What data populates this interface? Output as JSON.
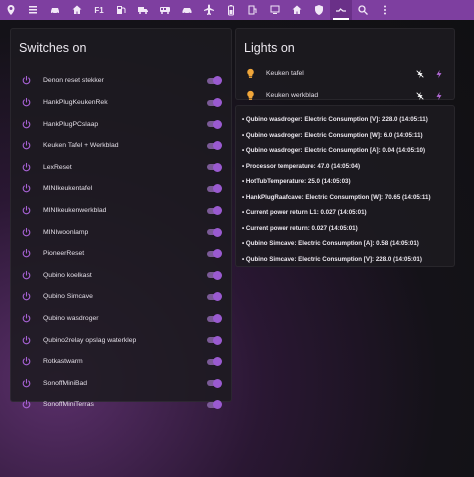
{
  "colors": {
    "accent": "#7e3fa0",
    "toggle_on": "#9a5ad0",
    "bulb": "#f0a63a",
    "bolt": "#b46ad8"
  },
  "toolbar": {
    "icons": [
      "map-marker-icon",
      "list-icon",
      "car-icon",
      "home-icon",
      "f1-icon",
      "fuel-icon",
      "truck-icon",
      "bus-icon",
      "car-icon",
      "plane-icon",
      "battery-icon",
      "charger-icon",
      "monitor-icon",
      "home-icon",
      "shield-icon",
      "switch-icon",
      "search-icon",
      "more-icon"
    ],
    "f1_label": "F1"
  },
  "switches_card": {
    "title": "Switches on",
    "items": [
      {
        "label": "Denon reset stekker",
        "state": "on"
      },
      {
        "label": "HankPlugKeukenRek",
        "state": "on"
      },
      {
        "label": "HankPlugPCslaap",
        "state": "on"
      },
      {
        "label": "Keuken Tafel + Werkblad",
        "state": "on"
      },
      {
        "label": "LexReset",
        "state": "on"
      },
      {
        "label": "MINIkeukentafel",
        "state": "on"
      },
      {
        "label": "MINIkeukenwerkblad",
        "state": "on"
      },
      {
        "label": "MINIwoonlamp",
        "state": "on"
      },
      {
        "label": "PioneerReset",
        "state": "on"
      },
      {
        "label": "Qubino koelkast",
        "state": "on"
      },
      {
        "label": "Qubino Simcave",
        "state": "on"
      },
      {
        "label": "Qubino wasdroger",
        "state": "on"
      },
      {
        "label": "Qubino2relay opslag waterklep",
        "state": "on"
      },
      {
        "label": "Rotkastwarm",
        "state": "on"
      },
      {
        "label": "SonoffMiniBad",
        "state": "on"
      },
      {
        "label": "SonoffMiniTerras",
        "state": "on"
      }
    ]
  },
  "lights_card": {
    "title": "Lights on",
    "items": [
      {
        "label": "Keuken tafel"
      },
      {
        "label": "Keuken werkblad"
      }
    ]
  },
  "sensors_card": {
    "items": [
      "• Qubino wasdroger: Electric Consumption [V]: 228.0 (14:05:11)",
      "• Qubino wasdroger: Electric Consumption [W]: 6.0 (14:05:11)",
      "• Qubino wasdroger: Electric Consumption [A]: 0.04 (14:05:10)",
      "• Processor temperature: 47.0 (14:05:04)",
      "• HotTubTemperature: 25.0 (14:05:03)",
      "• HankPlugRaafcave: Electric Consumption [W]: 70.65 (14:05:11)",
      "• Current power return L1: 0.027 (14:05:01)",
      "• Current power return: 0.027 (14:05:01)",
      "• Qubino Simcave: Electric Consumption [A]: 0.58 (14:05:01)",
      "• Qubino Simcave: Electric Consumption [V]: 228.0 (14:05:01)"
    ]
  }
}
